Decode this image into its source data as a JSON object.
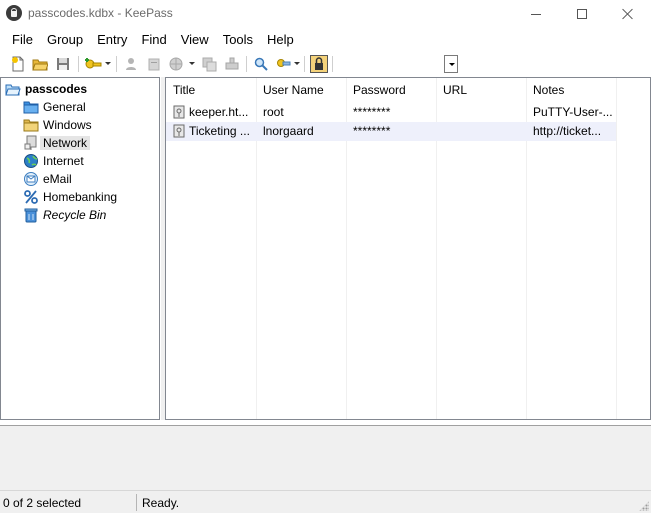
{
  "window": {
    "title": "passcodes.kdbx - KeePass"
  },
  "menu": [
    "File",
    "Group",
    "Entry",
    "Find",
    "View",
    "Tools",
    "Help"
  ],
  "toolbar": {
    "icons": [
      "new-database-icon",
      "open-database-icon",
      "save-icon",
      "add-entry-icon",
      "edit-entry-icon",
      "delete-entry-icon",
      "copy-username-icon",
      "copy-password-icon",
      "autotype-icon",
      "find-icon",
      "show-entries-icon",
      "lock-workspace-icon"
    ],
    "quickfind_value": ""
  },
  "tree": {
    "root": "passcodes",
    "groups": [
      {
        "label": "General",
        "icon": "folder-icon",
        "selected": false,
        "italic": false
      },
      {
        "label": "Windows",
        "icon": "windows-icon",
        "selected": false,
        "italic": false
      },
      {
        "label": "Network",
        "icon": "network-icon",
        "selected": true,
        "italic": false
      },
      {
        "label": "Internet",
        "icon": "globe-icon",
        "selected": false,
        "italic": false
      },
      {
        "label": "eMail",
        "icon": "email-icon",
        "selected": false,
        "italic": false
      },
      {
        "label": "Homebanking",
        "icon": "percent-icon",
        "selected": false,
        "italic": false
      },
      {
        "label": "Recycle Bin",
        "icon": "recycle-bin-icon",
        "selected": false,
        "italic": true
      }
    ]
  },
  "list": {
    "columns": [
      "Title",
      "User Name",
      "Password",
      "URL",
      "Notes"
    ],
    "rows": [
      {
        "title": "keeper.ht...",
        "username": "root",
        "password": "********",
        "url": "",
        "notes": "PuTTY-User-..."
      },
      {
        "title": "Ticketing ...",
        "username": "lnorgaard",
        "password": "********",
        "url": "",
        "notes": "http://ticket..."
      }
    ]
  },
  "status": {
    "selection": "0 of 2 selected",
    "state": "Ready."
  },
  "colors": {
    "row_alt": "#eef0fb",
    "selection": "#e5e5e5",
    "border": "#828790",
    "chrome": "#f0f0f0"
  }
}
